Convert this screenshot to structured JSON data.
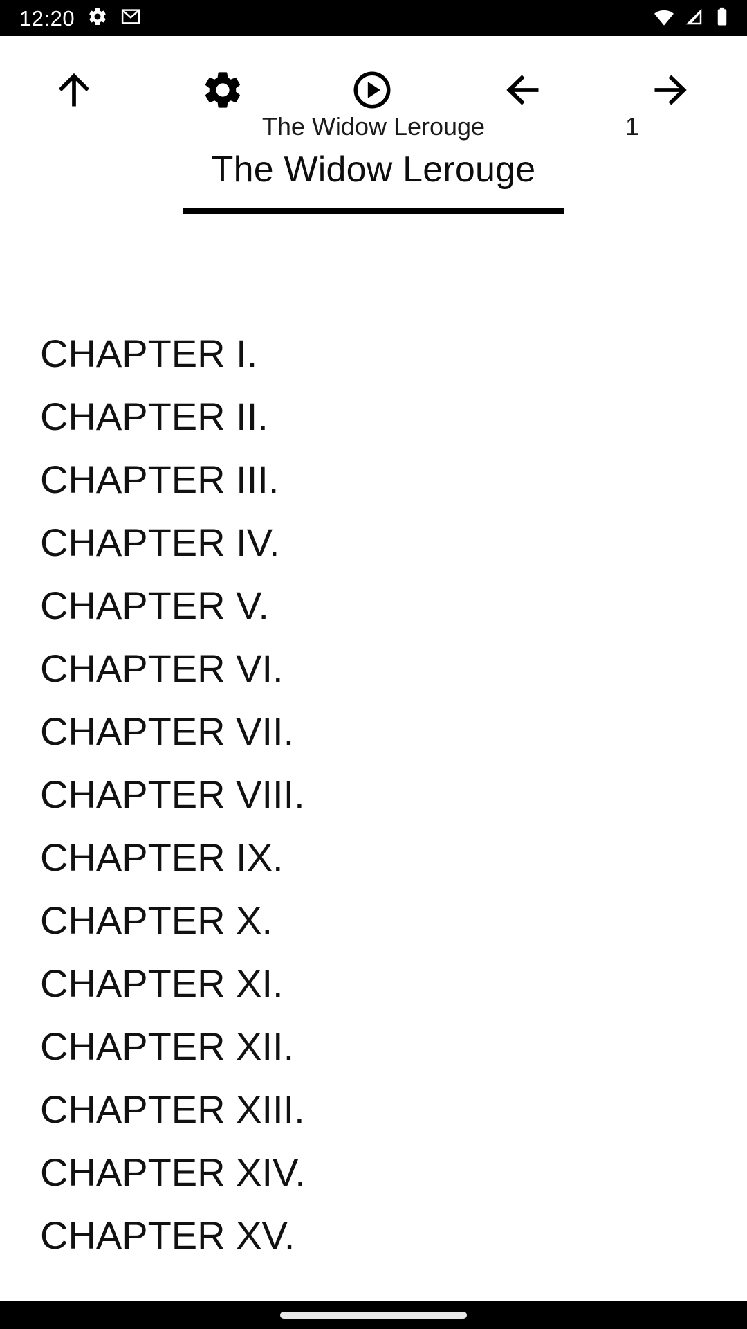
{
  "status_bar": {
    "time": "12:20",
    "left_icons": [
      {
        "name": "settings-gear-icon",
        "label": "gear-icon"
      },
      {
        "name": "gmail-icon",
        "label": "mail-icon"
      }
    ],
    "right_icons": [
      {
        "name": "wifi-icon",
        "label": "wifi-icon"
      },
      {
        "name": "cellular-signal-icon",
        "label": "signal-icon"
      },
      {
        "name": "battery-icon",
        "label": "battery-full-icon"
      }
    ],
    "background_color": "#000000",
    "foreground_color": "#ffffff"
  },
  "toolbar": {
    "background_color": "#ffffff",
    "buttons": [
      {
        "name": "scroll-to-top-button",
        "icon": "arrow-up-icon",
        "label": "Up"
      },
      {
        "name": "settings-button",
        "icon": "gear-icon",
        "label": "Settings"
      },
      {
        "name": "play-button",
        "icon": "play-circle-icon",
        "label": "Play"
      },
      {
        "name": "previous-page-button",
        "icon": "arrow-left-icon",
        "label": "Previous"
      },
      {
        "name": "next-page-button",
        "icon": "arrow-right-icon",
        "label": "Next"
      }
    ]
  },
  "header": {
    "book_title": "The Widow Lerouge",
    "page_number": "1",
    "chapter_heading": "The Widow Lerouge",
    "rule_color": "#000000"
  },
  "content": {
    "text_color": "#111111",
    "background_color": "#ffffff",
    "toc_items": [
      {
        "label": "CHAPTER I."
      },
      {
        "label": "CHAPTER II."
      },
      {
        "label": "CHAPTER III."
      },
      {
        "label": "CHAPTER IV."
      },
      {
        "label": "CHAPTER V."
      },
      {
        "label": "CHAPTER VI."
      },
      {
        "label": "CHAPTER VII."
      },
      {
        "label": "CHAPTER VIII."
      },
      {
        "label": "CHAPTER IX."
      },
      {
        "label": "CHAPTER X."
      },
      {
        "label": "CHAPTER XI."
      },
      {
        "label": "CHAPTER XII."
      },
      {
        "label": "CHAPTER XIII."
      },
      {
        "label": "CHAPTER XIV."
      },
      {
        "label": "CHAPTER XV."
      }
    ]
  },
  "nav_bar": {
    "background_color": "#000000",
    "home_indicator_color": "#e8e8e8"
  }
}
